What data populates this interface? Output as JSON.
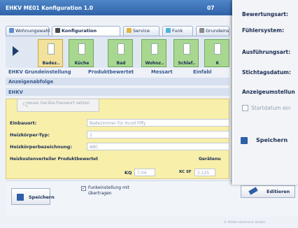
{
  "window": {
    "title": "EHKV ME01  Konfiguration  1.0",
    "title_right": "07"
  },
  "tabs": [
    {
      "label": "Wohnungswahl"
    },
    {
      "label": "Konfiguration"
    },
    {
      "label": "Service"
    },
    {
      "label": "Funk"
    },
    {
      "label": "Grundeinst"
    }
  ],
  "rooms": [
    {
      "label": "Badez.."
    },
    {
      "label": "Küche"
    },
    {
      "label": "Bad"
    },
    {
      "label": "Wohnz.."
    },
    {
      "label": "Schlaf.."
    },
    {
      "label": "K"
    }
  ],
  "subheader": {
    "col1": "EHKV Grundeinstellung",
    "col2": "Produktbewertet",
    "col3": "Messart",
    "col4": "Einfabl"
  },
  "sections": {
    "anzeigenabfolge": "Anzeigenabfolge",
    "ehkv": "EHKV"
  },
  "password_button": {
    "label": "neues Geräte-Passwort setzen"
  },
  "fields": {
    "einbauort_label": "Einbauort:",
    "einbauort_value": "Badezimmer für Hund Fiffy",
    "heizkoerper_typ_label": "Heizkörper-Typ:",
    "heizkoerper_typ_value": "1",
    "heizkoerperbezeichnung_label": "Heizkörperbezeichnung:",
    "heizkoerperbezeichnung_value": "ABC"
  },
  "product_rated": {
    "title": "Heizkostenverteiler Produktbewertet",
    "right_label": "Gerätenu",
    "kq_label": "KQ",
    "kq_value": "7,04",
    "kcsf_label": "KC SF",
    "kcsf_value": "2,125"
  },
  "bottom": {
    "save_label": "Speichern",
    "checkbox_label_line1": "Funkeinstellung mit",
    "checkbox_label_line2": "übertragen",
    "checkbox_checked": "✓",
    "edit_label": "Editieren",
    "footer": "© Müller-electronic GmbH"
  },
  "popup": {
    "bewertungsart": "Bewertungsart:",
    "fuehlersystem": "Fühlersystem:",
    "ausfuehrungsart": "Ausführungsart:",
    "stichtagsdatum": "Stichtagsdatum:",
    "anzeigeumstellung": "Anzeigeumstellun",
    "startdatum": "Startdatum ein",
    "save_label": "Speichern"
  },
  "colors": {
    "accent": "#2f63a8",
    "room_green": "#a8d890",
    "room_selected": "#f3e29c",
    "panel_yellow": "#f8efaa"
  }
}
